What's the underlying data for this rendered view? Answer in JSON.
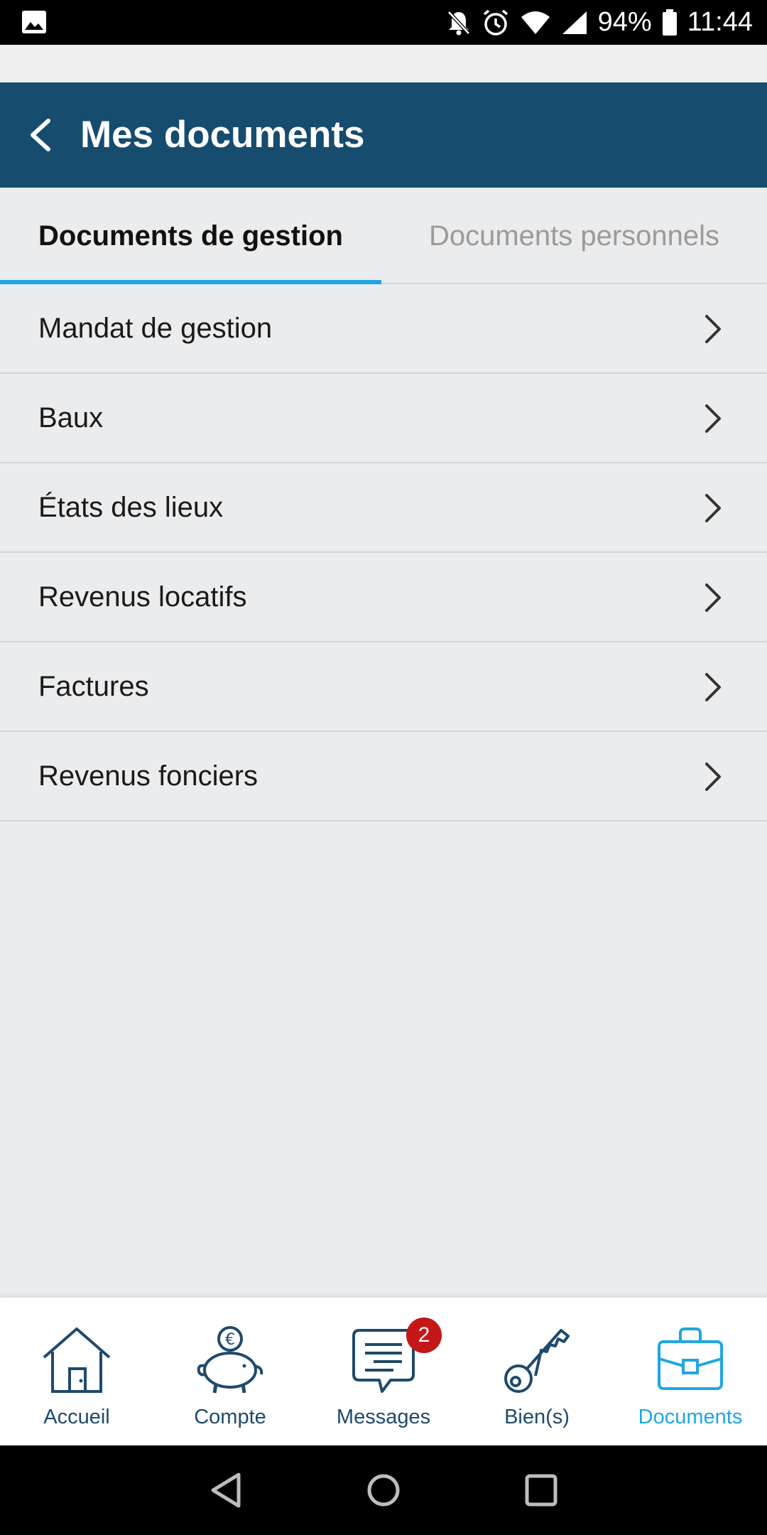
{
  "status_bar": {
    "battery": "94%",
    "time": "11:44",
    "icons": [
      "image-icon",
      "bell-off-icon",
      "alarm-icon",
      "wifi-icon",
      "signal-icon",
      "battery-icon"
    ]
  },
  "app_bar": {
    "title": "Mes documents",
    "background": "#164c6e"
  },
  "tabs": [
    {
      "label": "Documents de gestion",
      "active": true
    },
    {
      "label": "Documents personnels",
      "active": false
    }
  ],
  "list": {
    "items": [
      {
        "label": "Mandat de gestion"
      },
      {
        "label": "Baux"
      },
      {
        "label": "États des lieux"
      },
      {
        "label": "Revenus locatifs"
      },
      {
        "label": "Factures"
      },
      {
        "label": "Revenus fonciers"
      }
    ]
  },
  "bottom_nav": {
    "items": [
      {
        "label": "Accueil",
        "icon": "house-icon",
        "active": false
      },
      {
        "label": "Compte",
        "icon": "piggy-bank-icon",
        "active": false
      },
      {
        "label": "Messages",
        "icon": "message-icon",
        "active": false,
        "badge": "2"
      },
      {
        "label": "Bien(s)",
        "icon": "key-icon",
        "active": false
      },
      {
        "label": "Documents",
        "icon": "briefcase-icon",
        "active": true
      }
    ],
    "active_color": "#1ea7df",
    "inactive_color": "#1f4a6b",
    "badge_color": "#c41717"
  }
}
